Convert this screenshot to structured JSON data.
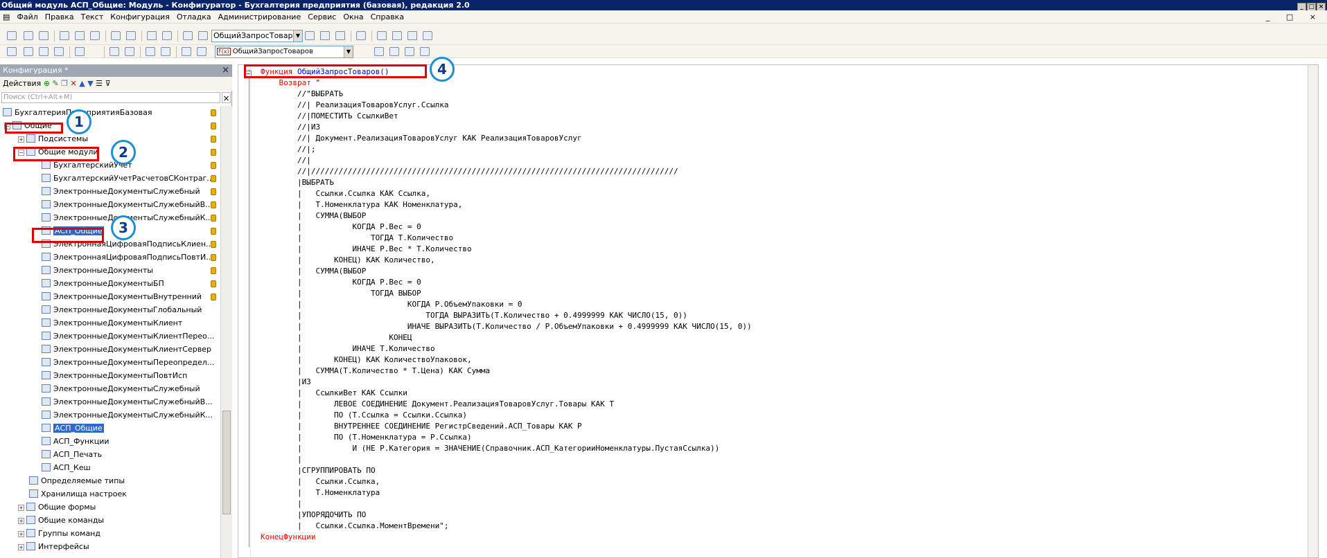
{
  "title": "Общий модуль АСП_Общие: Модуль - Конфигуратор - Бухгалтерия предприятия (базовая), редакция 2.0",
  "menu": [
    "Файл",
    "Правка",
    "Текст",
    "Конфигурация",
    "Отладка",
    "Администрирование",
    "Сервис",
    "Окна",
    "Справка"
  ],
  "toolbar": {
    "search_value": "ОбщийЗапросТоваров",
    "procedure_value": "ОбщийЗапросТоваров",
    "procedure_badge": "F(x)"
  },
  "config_panel": {
    "title": "Конфигурация *",
    "actions_label": "Действия",
    "search_placeholder": "Поиск (Ctrl+Alt+M)"
  },
  "tree": [
    "БухгалтерияПредприятияБазовая",
    "Общие",
    "Подсистемы",
    "Общие модули",
    "БухгалтерскийУчет",
    "БухгалтерскийУчетРасчетовСКонтраг...",
    "ЭлектронныеДокументыСлужебный",
    "ЭлектронныеДокументыСлужебныйВ...",
    "ЭлектронныеДокументыСлужебныйК...",
    "АСП_Общие",
    "ЭлектроннаяЦифроваяПодписьКлиен...",
    "ЭлектроннаяЦифроваяПодписьПовтИ...",
    "ЭлектронныеДокументы",
    "ЭлектронныеДокументыБП",
    "ЭлектронныеДокументыВнутренний",
    "ЭлектронныеДокументыГлобальный",
    "ЭлектронныеДокументыКлиент",
    "ЭлектронныеДокументыКлиентПерео...",
    "ЭлектронныеДокументыКлиентСервер",
    "ЭлектронныеДокументыПереопредел...",
    "ЭлектронныеДокументыПовтИсп",
    "ЭлектронныеДокументыСлужебный",
    "ЭлектронныеДокументыСлужебныйВ...",
    "ЭлектронныеДокументыСлужебныйК...",
    "АСП_Общие",
    "АСП_Функции",
    "АСП_Печать",
    "АСП_Кеш",
    "Определяемые типы",
    "Хранилища настроек",
    "Общие формы",
    "Общие команды",
    "Группы команд",
    "Интерфейсы"
  ],
  "annotations": [
    "1",
    "2",
    "3",
    "4"
  ],
  "code": {
    "kw_function": "Функция",
    "func_name": "ОбщийЗапросТоваров()",
    "kw_return": "Возврат",
    "return_tail": " \"",
    "kw_end": "КонецФункции",
    "lines": [
      "        //\"ВЫБРАТЬ",
      "        //| РеализацияТоваровУслуг.Ссылка",
      "        //|ПОМЕСТИТЬ СсылкиВет",
      "        //|ИЗ",
      "        //| Документ.РеализацияТоваровУслуг КАК РеализацияТоваровУслуг",
      "        //|;",
      "        //|",
      "        //|////////////////////////////////////////////////////////////////////////////////",
      "        |ВЫБРАТЬ",
      "        |   Ссылки.Ссылка КАК Ссылка,",
      "        |   Т.Номенклатура КАК Номенклатура,",
      "        |   СУММА(ВЫБОР",
      "        |           КОГДА Р.Вес = 0",
      "        |               ТОГДА Т.Количество",
      "        |           ИНАЧЕ Р.Вес * Т.Количество",
      "        |       КОНЕЦ) КАК Количество,",
      "        |   СУММА(ВЫБОР",
      "        |           КОГДА Р.Вес = 0",
      "        |               ТОГДА ВЫБОР",
      "        |                       КОГДА Р.ОбъемУпаковки = 0",
      "        |                           ТОГДА ВЫРАЗИТЬ(Т.Количество + 0.4999999 КАК ЧИСЛО(15, 0))",
      "        |                       ИНАЧЕ ВЫРАЗИТЬ(Т.Количество / Р.ОбъемУпаковки + 0.4999999 КАК ЧИСЛО(15, 0))",
      "        |                   КОНЕЦ",
      "        |           ИНАЧЕ Т.Количество",
      "        |       КОНЕЦ) КАК КоличествоУпаковок,",
      "        |   СУММА(Т.Количество * Т.Цена) КАК Сумма",
      "        |ИЗ",
      "        |   СсылкиВет КАК Ссылки",
      "        |       ЛЕВОЕ СОЕДИНЕНИЕ Документ.РеализацияТоваровУслуг.Товары КАК Т",
      "        |       ПО (Т.Ссылка = Ссылки.Ссылка)",
      "        |       ВНУТРЕННЕЕ СОЕДИНЕНИЕ РегистрСведений.АСП_Товары КАК Р",
      "        |       ПО (Т.Номенклатура = Р.Ссылка)",
      "        |           И (НЕ Р.Категория = ЗНАЧЕНИЕ(Справочник.АСП_КатегорииНоменклатуры.ПустаяСсылка))",
      "        |",
      "        |СГРУППИРОВАТЬ ПО",
      "        |   Ссылки.Ссылка,",
      "        |   Т.Номенклатура",
      "        |",
      "        |УПОРЯДОЧИТЬ ПО",
      "        |   Ссылки.Ссылка.МоментВремени\";"
    ]
  }
}
